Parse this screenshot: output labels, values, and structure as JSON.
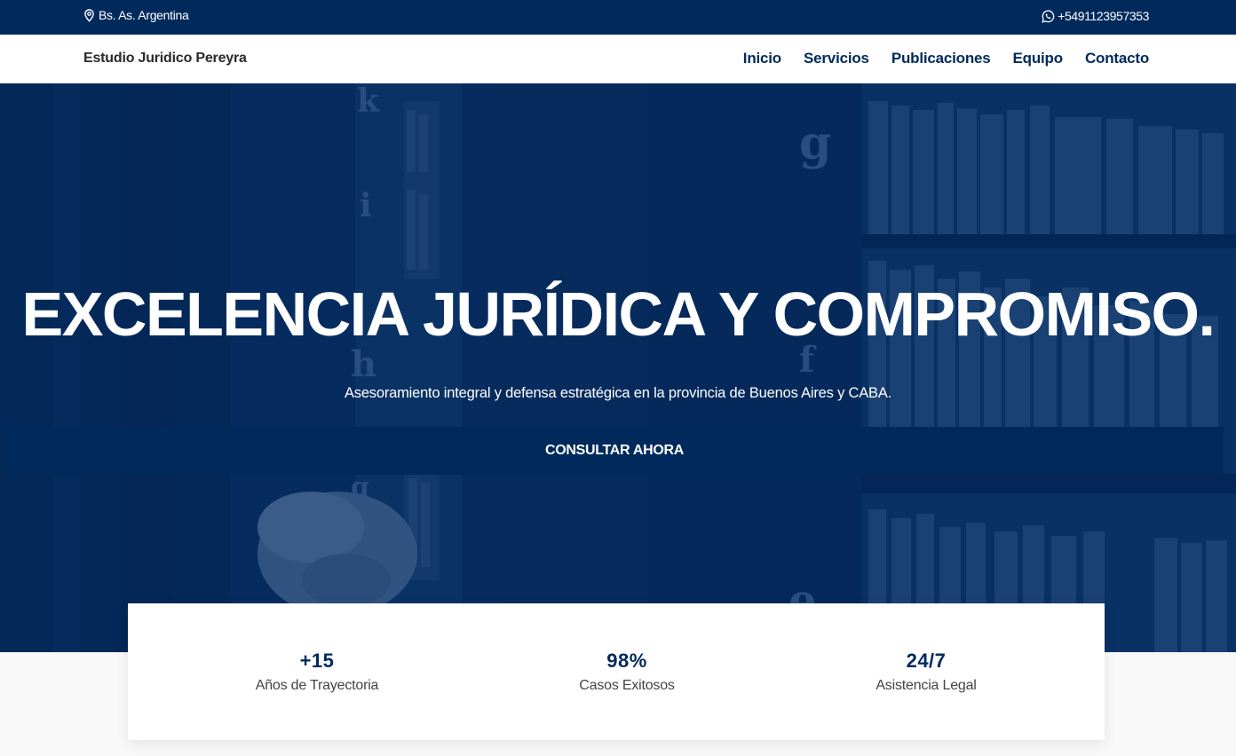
{
  "topbar": {
    "location": "Bs. As. Argentina",
    "phone": "+5491123957353",
    "location_icon": "map-pin-icon",
    "phone_icon": "whatsapp-icon"
  },
  "navbar": {
    "brand": "Estudio Juridico Pereyra",
    "links": [
      "Inicio",
      "Servicios",
      "Publicaciones",
      "Equipo",
      "Contacto"
    ]
  },
  "hero": {
    "title": "EXCELENCIA JURÍDICA Y COMPROMISO.",
    "subtitle": "Asesoramiento integral y defensa estratégica en la provincia de Buenos Aires y CABA.",
    "cta": "CONSULTAR AHORA"
  },
  "stats": [
    {
      "value": "+15",
      "label": "Años de Trayectoria"
    },
    {
      "value": "98%",
      "label": "Casos Exitosos"
    },
    {
      "value": "24/7",
      "label": "Asistencia Legal"
    }
  ],
  "colors": {
    "primary": "#002a5c",
    "white": "#ffffff",
    "text": "#444444"
  }
}
